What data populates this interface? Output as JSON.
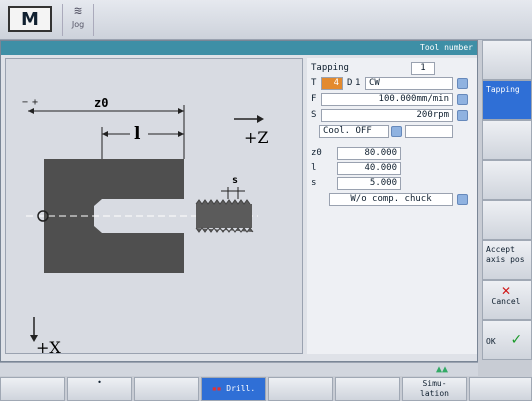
{
  "topbar": {
    "machine_label": "M",
    "jog_label": "Jog"
  },
  "window": {
    "title": "Tool number"
  },
  "sketch": {
    "z0": "z0",
    "l": "l",
    "s": "s",
    "plus_z": "+Z",
    "plus_x": "+X",
    "minus": "−",
    "plus": "+"
  },
  "form": {
    "cycle_name": "Tapping",
    "cycle_index": "1",
    "t_label": "T",
    "t_value": "4",
    "d_label": "D",
    "d_value": "1",
    "direction": "CW",
    "f_label": "F",
    "f_value": "100.000mm/min",
    "s_label": "S",
    "s_value": "200rpm",
    "coolant": "Cool. OFF",
    "z0_label": "z0",
    "z0_value": "80.000",
    "l_label": "l",
    "l_value": "40.000",
    "s2_label": "s",
    "s2_value": "5.000",
    "chuck_mode": "W/o comp. chuck"
  },
  "right_softkeys": {
    "tapping": "Tapping",
    "accept": "Accept\naxis pos",
    "cancel": "Cancel",
    "ok": "OK"
  },
  "bottom_softkeys": {
    "drill": "Drill.",
    "simulation": "Simu-\nlation"
  },
  "colors": {
    "accent": "#2f6fd6",
    "title": "#3e8fa6",
    "workpiece": "#555555"
  }
}
